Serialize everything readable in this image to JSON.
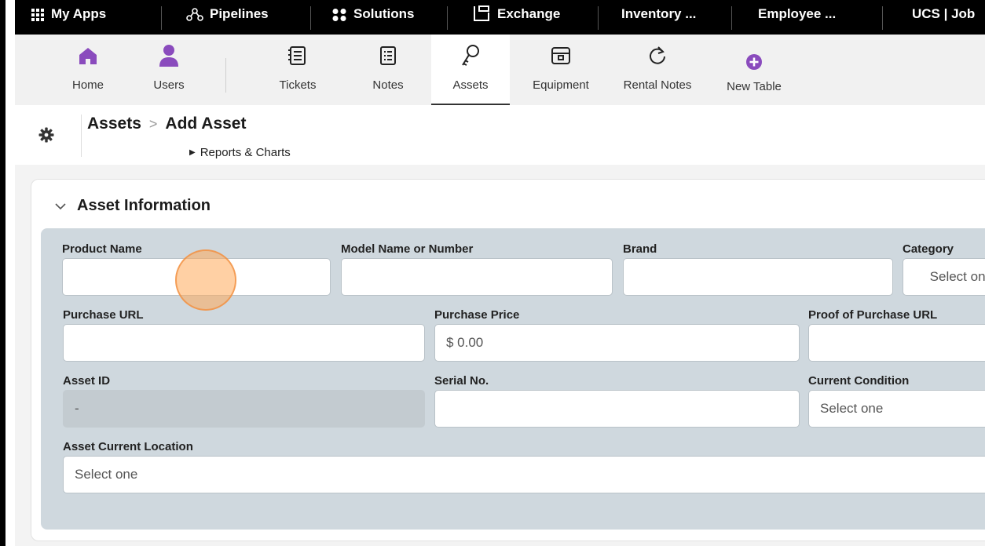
{
  "topbar": {
    "apps": [
      {
        "label": "My Apps",
        "icon": "grid-icon"
      },
      {
        "label": "Pipelines",
        "icon": "pipelines-icon"
      },
      {
        "label": "Solutions",
        "icon": "solutions-icon"
      },
      {
        "label": "Exchange",
        "icon": "exchange-icon"
      },
      {
        "label": "Inventory ...",
        "icon": ""
      },
      {
        "label": "Employee ...",
        "icon": ""
      },
      {
        "label": "UCS | Job",
        "icon": ""
      }
    ]
  },
  "toolbar": {
    "items": [
      {
        "label": "Home",
        "icon": "home-icon"
      },
      {
        "label": "Users",
        "icon": "user-icon"
      },
      {
        "label": "Tickets",
        "icon": "tickets-icon"
      },
      {
        "label": "Notes",
        "icon": "notes-icon"
      },
      {
        "label": "Assets",
        "icon": "key-icon"
      },
      {
        "label": "Equipment",
        "icon": "equipment-icon"
      },
      {
        "label": "Rental Notes",
        "icon": "refresh-icon"
      },
      {
        "label": "New Table",
        "icon": "plus-circle-icon"
      }
    ],
    "active": "Assets"
  },
  "header": {
    "breadcrumb_parent": "Assets",
    "breadcrumb_separator": ">",
    "breadcrumb_current": "Add Asset",
    "reports_link": "Reports & Charts"
  },
  "section": {
    "title": "Asset Information"
  },
  "fields": {
    "product_name": {
      "label": "Product Name",
      "value": ""
    },
    "model_name": {
      "label": "Model Name or Number",
      "value": ""
    },
    "brand": {
      "label": "Brand",
      "value": ""
    },
    "category": {
      "label": "Category",
      "placeholder": "Select one"
    },
    "purchase_url": {
      "label": "Purchase URL",
      "value": ""
    },
    "purchase_price": {
      "label": "Purchase Price",
      "placeholder": "$ 0.00"
    },
    "proof_url": {
      "label": "Proof of Purchase URL",
      "value": ""
    },
    "asset_id": {
      "label": "Asset ID",
      "value": "-"
    },
    "serial_no": {
      "label": "Serial No.",
      "value": ""
    },
    "current_condition": {
      "label": "Current Condition",
      "placeholder": "Select one"
    },
    "asset_location": {
      "label": "Asset Current Location",
      "placeholder": "Select one"
    }
  },
  "colors": {
    "accent_purple": "#8a4bbd",
    "panel_bg": "#cfd8de",
    "cursor_highlight": "#f5a45a"
  }
}
